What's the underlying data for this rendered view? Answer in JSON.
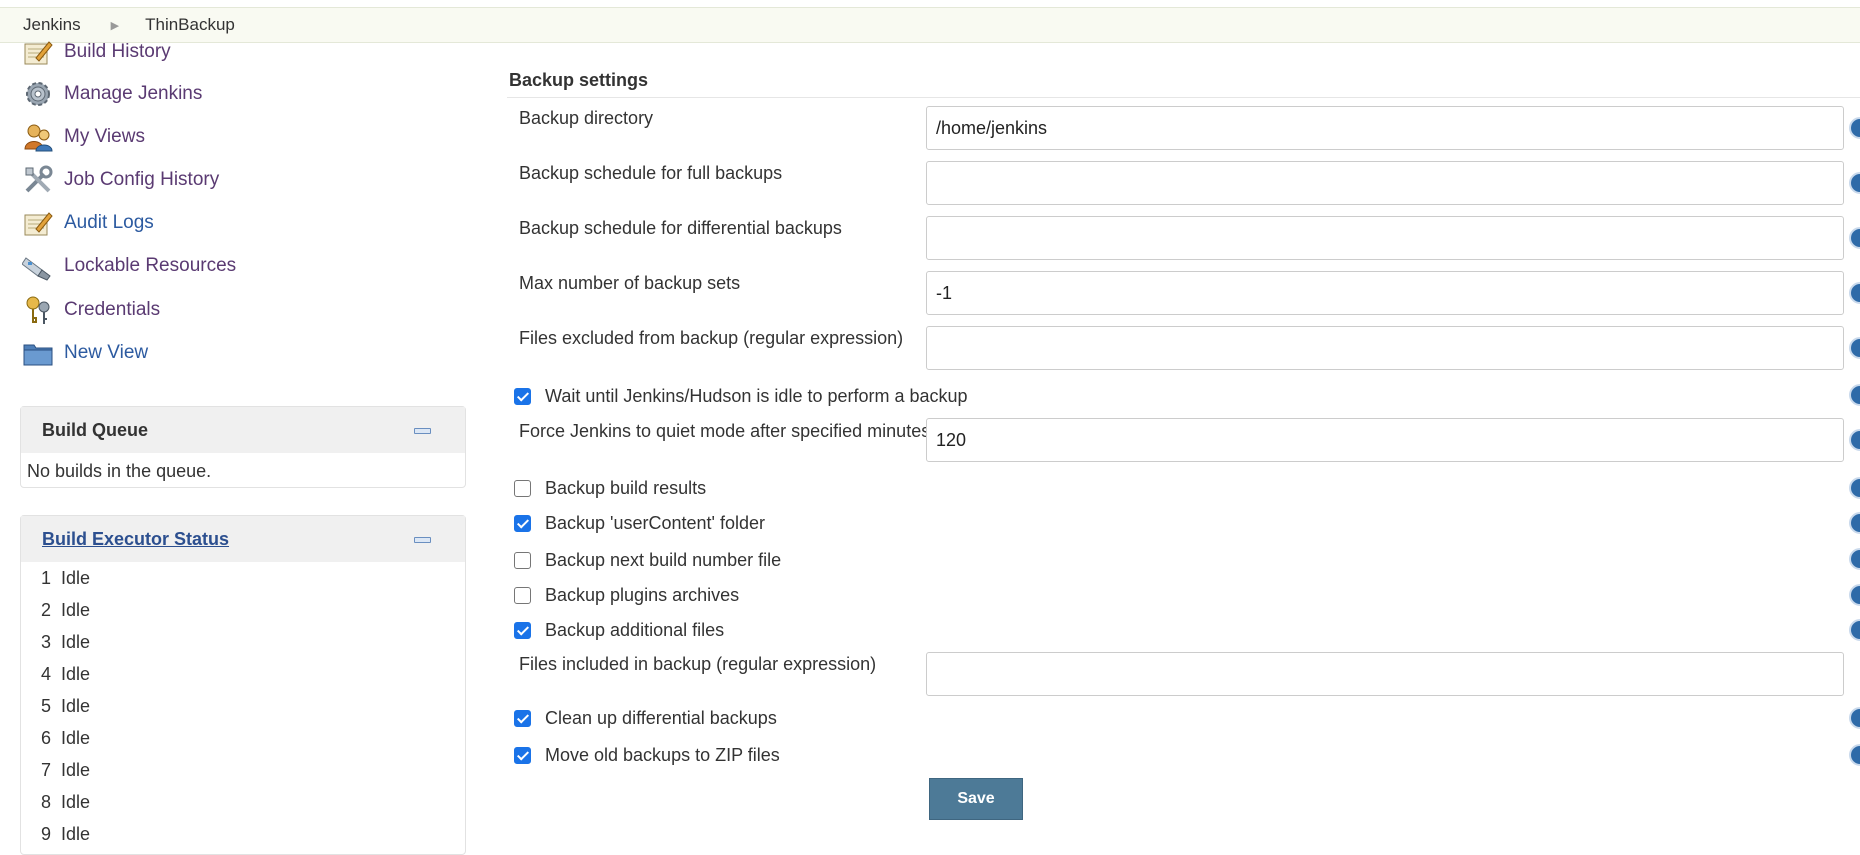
{
  "breadcrumb": {
    "items": [
      "Jenkins",
      "ThinBackup"
    ]
  },
  "sidebar": {
    "tasks": [
      {
        "label": "Build History",
        "icon": "notepad-icon"
      },
      {
        "label": "Manage Jenkins",
        "icon": "gear-icon"
      },
      {
        "label": "My Views",
        "icon": "users-icon"
      },
      {
        "label": "Job Config History",
        "icon": "tools-icon"
      },
      {
        "label": "Audit Logs",
        "icon": "notepad-icon"
      },
      {
        "label": "Lockable Resources",
        "icon": "usb-drive-icon"
      },
      {
        "label": "Credentials",
        "icon": "keys-icon"
      },
      {
        "label": "New View",
        "icon": "folder-icon"
      }
    ]
  },
  "build_queue": {
    "title": "Build Queue",
    "message": "No builds in the queue."
  },
  "executor_status": {
    "title": "Build Executor Status",
    "executors": [
      {
        "num": "1",
        "status": "Idle"
      },
      {
        "num": "2",
        "status": "Idle"
      },
      {
        "num": "3",
        "status": "Idle"
      },
      {
        "num": "4",
        "status": "Idle"
      },
      {
        "num": "5",
        "status": "Idle"
      },
      {
        "num": "6",
        "status": "Idle"
      },
      {
        "num": "7",
        "status": "Idle"
      },
      {
        "num": "8",
        "status": "Idle"
      },
      {
        "num": "9",
        "status": "Idle"
      }
    ]
  },
  "form": {
    "section_title": "Backup settings",
    "backup_directory": {
      "label": "Backup directory",
      "value": "/home/jenkins"
    },
    "full_schedule": {
      "label": "Backup schedule for full backups",
      "value": ""
    },
    "diff_schedule": {
      "label": "Backup schedule for differential backups",
      "value": ""
    },
    "max_sets": {
      "label": "Max number of backup sets",
      "value": "-1"
    },
    "excluded": {
      "label": "Files excluded from backup (regular expression)",
      "value": ""
    },
    "wait_idle": {
      "label": "Wait until Jenkins/Hudson is idle to perform a backup",
      "checked": true
    },
    "quiet_mode": {
      "label": "Force Jenkins to quiet mode after specified minutes",
      "value": "120"
    },
    "build_results": {
      "label": "Backup build results",
      "checked": false
    },
    "user_content": {
      "label": "Backup 'userContent' folder",
      "checked": true
    },
    "next_build_number": {
      "label": "Backup next build number file",
      "checked": false
    },
    "plugins_archives": {
      "label": "Backup plugins archives",
      "checked": false
    },
    "additional_files": {
      "label": "Backup additional files",
      "checked": true
    },
    "included": {
      "label": "Files included in backup (regular expression)",
      "value": ""
    },
    "cleanup_diff": {
      "label": "Clean up differential backups",
      "checked": true
    },
    "move_zip": {
      "label": "Move old backups to ZIP files",
      "checked": true
    },
    "save_label": "Save"
  },
  "colors": {
    "accent": "#4d7a97",
    "link": "#2c4f8f",
    "checkbox": "#1a73e8",
    "help": "#2e6aa8"
  }
}
